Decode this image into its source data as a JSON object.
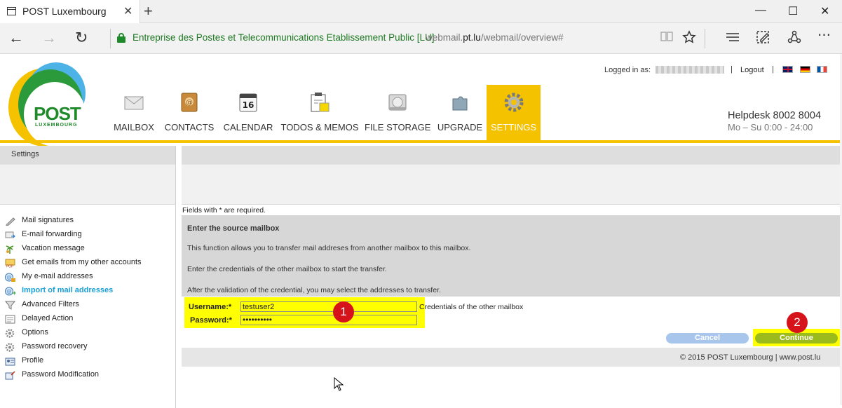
{
  "browser": {
    "tab_title": "POST Luxembourg",
    "tab_close": "✕",
    "new_tab": "+",
    "win_min": "—",
    "win_max": "☐",
    "win_close": "✕",
    "back": "←",
    "forward": "→",
    "refresh": "↻",
    "cert_text": "Entreprise des Postes et Telecommunications Etablissement Public [LU]",
    "url_prefix": "webmail.",
    "url_domain": "pt.lu",
    "url_path": "/webmail/overview#",
    "tool_icons": [
      "reading-view-icon",
      "favorite-star-icon",
      "hub-icon",
      "web-note-icon",
      "share-icon",
      "more-icon"
    ]
  },
  "header": {
    "logo_text": "POST",
    "logo_subtext": "LUXEMBOURG",
    "logged_in_label": "Logged in as:",
    "separator": "|",
    "logout": "Logout",
    "helpdesk": "Helpdesk 8002 8004",
    "hours": "Mo – Su 0:00 - 24:00",
    "flags": [
      "english-flag",
      "german-flag",
      "french-flag"
    ]
  },
  "nav": [
    {
      "label": "MAILBOX",
      "icon": "mailbox-icon"
    },
    {
      "label": "CONTACTS",
      "icon": "contacts-icon"
    },
    {
      "label": "CALENDAR",
      "icon": "calendar-icon",
      "icon_text": "16"
    },
    {
      "label": "TODOS & MEMOS",
      "icon": "todos-memos-icon"
    },
    {
      "label": "FILE STORAGE",
      "icon": "file-storage-icon"
    },
    {
      "label": "UPGRADE",
      "icon": "upgrade-icon"
    },
    {
      "label": "SETTINGS",
      "icon": "settings-icon",
      "active": true
    }
  ],
  "sidebar": {
    "title": "Settings",
    "items": [
      {
        "label": "Mail signatures",
        "icon": "signature-icon"
      },
      {
        "label": "E-mail forwarding",
        "icon": "forwarding-icon"
      },
      {
        "label": "Vacation message",
        "icon": "vacation-icon"
      },
      {
        "label": "Get emails from my other accounts",
        "icon": "pop-icon"
      },
      {
        "label": "My e-mail addresses",
        "icon": "email-address-icon"
      },
      {
        "label": "Import of mail addresses",
        "icon": "import-icon",
        "active": true
      },
      {
        "label": "Advanced Filters",
        "icon": "filter-icon"
      },
      {
        "label": "Delayed Action",
        "icon": "delayed-action-icon"
      },
      {
        "label": "Options",
        "icon": "options-gear-icon"
      },
      {
        "label": "Password recovery",
        "icon": "password-recovery-gear-icon"
      },
      {
        "label": "Profile",
        "icon": "profile-icon"
      },
      {
        "label": "Password Modification",
        "icon": "password-modification-icon"
      }
    ]
  },
  "main": {
    "required_note": "Fields with * are required.",
    "section_title": "Enter the source mailbox",
    "para1": "This function allows you to transfer mail addreses from another mailbox to this mailbox.",
    "para2": "Enter the credentials of the other mailbox to start the transfer.",
    "para3": "After the validation of the credential, you may select the addresses to transfer.",
    "username_label": "Username:*",
    "username_value": "testuser2",
    "password_label": "Password:*",
    "password_value": "••••••••••",
    "credentials_note": "Credentials of the other mailbox",
    "cancel": "Cancel",
    "continue": "Continue",
    "badge1": "1",
    "badge2": "2",
    "footer": "© 2015 POST Luxembourg   |   www.post.lu"
  },
  "colors": {
    "brand_yellow": "#f5c200",
    "highlight": "#ffff00",
    "link_blue": "#1a9fd6",
    "continue_green": "#9bbb1d",
    "cancel_blue": "#a8c6ec",
    "badge_red": "#d6121a"
  }
}
